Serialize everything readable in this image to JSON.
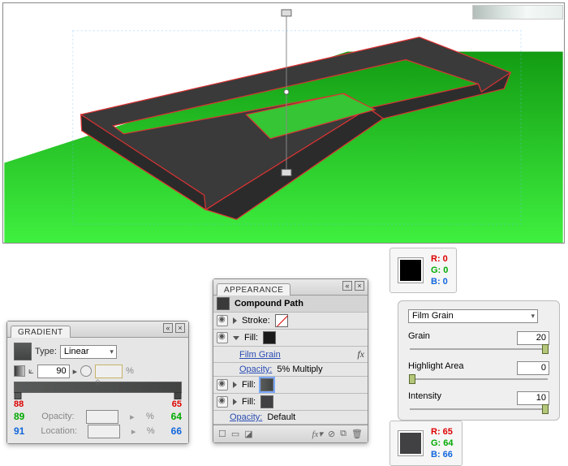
{
  "canvas_alt": "3D extruded letter A on green surface",
  "gradient": {
    "title": "GRADIENT",
    "type_label": "Type:",
    "type_value": "Linear",
    "angle": "90",
    "opacity_label": "Opacity:",
    "location_label": "Location:",
    "pct": "%",
    "left_r": "88",
    "left_g": "89",
    "left_b": "91",
    "right_r": "65",
    "right_g": "64",
    "right_b": "66"
  },
  "appearance": {
    "title": "APPEARANCE",
    "path_label": "Compound Path",
    "stroke_label": "Stroke:",
    "fill_label": "Fill:",
    "effect": "Film Grain",
    "opacity_label": "Opacity:",
    "opacity_val": "5% Multiply",
    "opacity_default": "Default"
  },
  "chip1": {
    "r_label": "R: 0",
    "g_label": "G: 0",
    "b_label": "B: 0",
    "hex": "#000000"
  },
  "chip2": {
    "r_label": "R: 65",
    "g_label": "G: 64",
    "b_label": "B: 66",
    "hex": "#414042"
  },
  "filter": {
    "name": "Film Grain",
    "grain_label": "Grain",
    "grain_val": "20",
    "highlight_label": "Highlight Area",
    "highlight_val": "0",
    "intensity_label": "Intensity",
    "intensity_val": "10"
  }
}
